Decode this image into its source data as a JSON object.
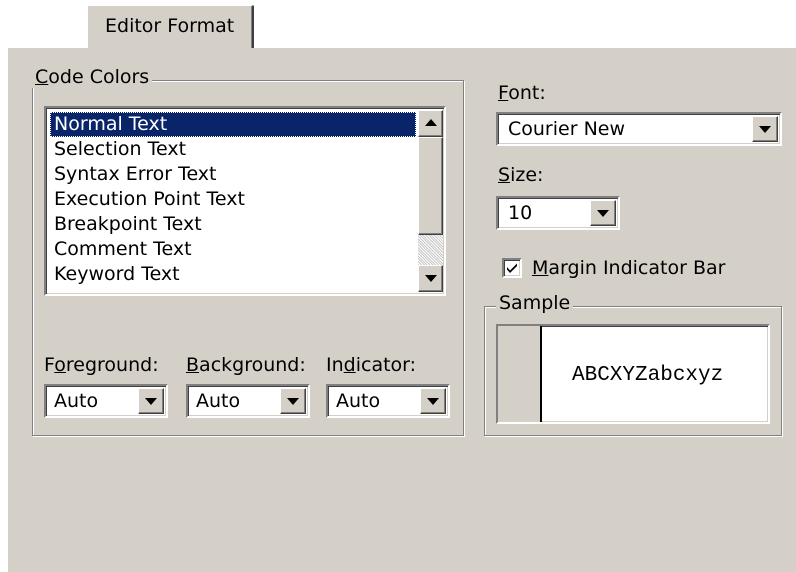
{
  "tab": {
    "label": "Editor Format"
  },
  "code_colors": {
    "legend_accel": "C",
    "legend_rest": "ode Colors",
    "items": [
      "Normal Text",
      "Selection Text",
      "Syntax Error Text",
      "Execution Point Text",
      "Breakpoint Text",
      "Comment Text",
      "Keyword Text"
    ],
    "selected_index": 0
  },
  "foreground": {
    "label_pre": "F",
    "label_accel": "o",
    "label_post": "reground:",
    "value": "Auto"
  },
  "background": {
    "label_pre": "",
    "label_accel": "B",
    "label_post": "ackground:",
    "value": "Auto"
  },
  "indicator": {
    "label_pre": "In",
    "label_accel": "d",
    "label_post": "icator:",
    "value": "Auto"
  },
  "font": {
    "label_accel": "F",
    "label_rest": "ont:",
    "value": "Courier New"
  },
  "size": {
    "label_accel": "S",
    "label_rest": "ize:",
    "value": "10"
  },
  "margin_indicator": {
    "label_accel": "M",
    "label_rest": "argin Indicator Bar",
    "checked": true
  },
  "sample": {
    "legend": "Sample",
    "text": "ABCXYZabcxyz"
  },
  "icons": {
    "dropdown": "chevron-down-icon",
    "scroll_up": "arrow-up-icon",
    "scroll_down": "arrow-down-icon",
    "check": "checkmark-icon"
  },
  "colors": {
    "face": "#d4d0c8",
    "selection": "#0a246a"
  }
}
